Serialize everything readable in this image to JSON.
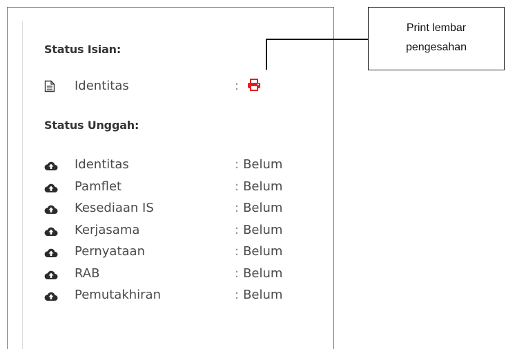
{
  "status_isian": {
    "heading": "Status Isian:",
    "items": [
      {
        "icon": "document-icon",
        "label": "Identitas",
        "colon": ":",
        "action_icon": "print-icon",
        "action_color": "#e02020"
      }
    ]
  },
  "status_unggah": {
    "heading": "Status Unggah:",
    "items": [
      {
        "icon": "cloud-upload-icon",
        "label": "Identitas",
        "colon": ":",
        "value": "Belum"
      },
      {
        "icon": "cloud-upload-icon",
        "label": "Pamflet",
        "colon": ":",
        "value": "Belum"
      },
      {
        "icon": "cloud-upload-icon",
        "label": "Kesediaan IS",
        "colon": ":",
        "value": "Belum"
      },
      {
        "icon": "cloud-upload-icon",
        "label": "Kerjasama",
        "colon": ":",
        "value": "Belum"
      },
      {
        "icon": "cloud-upload-icon",
        "label": "Pernyataan",
        "colon": ":",
        "value": "Belum"
      },
      {
        "icon": "cloud-upload-icon",
        "label": "RAB",
        "colon": ":",
        "value": "Belum"
      },
      {
        "icon": "cloud-upload-icon",
        "label": "Pemutakhiran",
        "colon": ":",
        "value": "Belum"
      }
    ]
  },
  "callout": {
    "line1": "Print lembar",
    "line2": "pengesahan"
  },
  "colors": {
    "panel_border": "#4a7bc4",
    "print_icon": "#e02020",
    "text": "#4a4a4a"
  }
}
